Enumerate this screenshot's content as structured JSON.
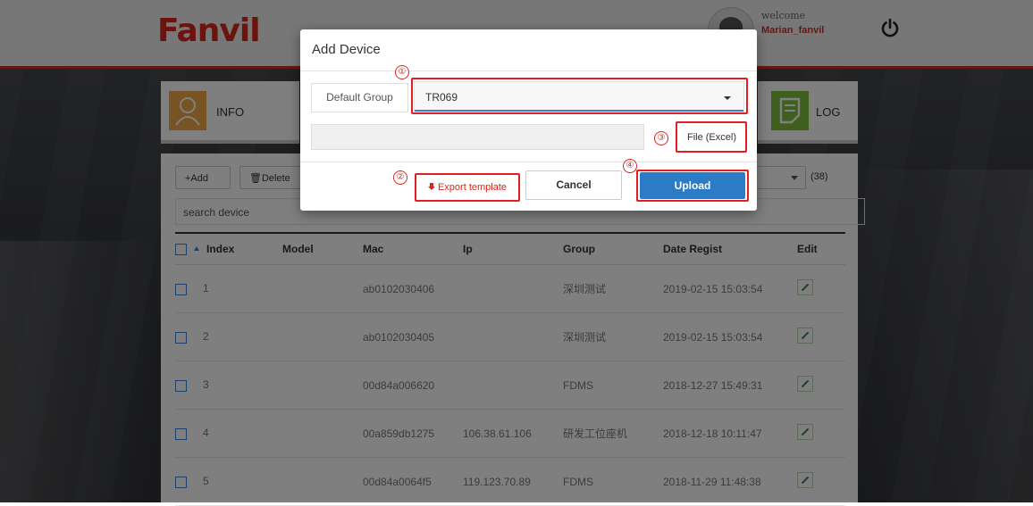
{
  "header": {
    "logo": "Fanvil",
    "welcome": "welcome",
    "username": "Marian_fanvil"
  },
  "tiles": {
    "info": "INFO",
    "log": "LOG"
  },
  "toolbar": {
    "add_label": "+Add",
    "delete_label": "Delete",
    "search_placeholder": "search device",
    "count": "(38)"
  },
  "table": {
    "headers": [
      "Index",
      "Model",
      "Mac",
      "Ip",
      "Group",
      "Date Regist",
      "Edit"
    ],
    "rows": [
      {
        "index": "1",
        "model": "",
        "mac": "ab0102030406",
        "ip": "",
        "group": "深圳测试",
        "date": "2019-02-15 15:03:54"
      },
      {
        "index": "2",
        "model": "",
        "mac": "ab0102030405",
        "ip": "",
        "group": "深圳测试",
        "date": "2019-02-15 15:03:54"
      },
      {
        "index": "3",
        "model": "",
        "mac": "00d84a006620",
        "ip": "",
        "group": "FDMS",
        "date": "2018-12-27 15:49:31"
      },
      {
        "index": "4",
        "model": "",
        "mac": "00a859db1275",
        "ip": "106.38.61.106",
        "group": "研发工位座机",
        "date": "2018-12-18 10:11:47"
      },
      {
        "index": "5",
        "model": "",
        "mac": "00d84a0064f5",
        "ip": "119.123.70.89",
        "group": "FDMS",
        "date": "2018-11-29 11:48:38"
      }
    ]
  },
  "modal": {
    "title": "Add Device",
    "group_label": "Default Group",
    "group_value": "TR069",
    "file_button": "File (Excel)",
    "export_button": "Export template",
    "cancel_button": "Cancel",
    "upload_button": "Upload",
    "markers": [
      "①",
      "②",
      "③",
      "④"
    ]
  },
  "colors": {
    "brand": "#d9261c",
    "primary": "#2b7cc4",
    "highlight": "#e02020"
  }
}
